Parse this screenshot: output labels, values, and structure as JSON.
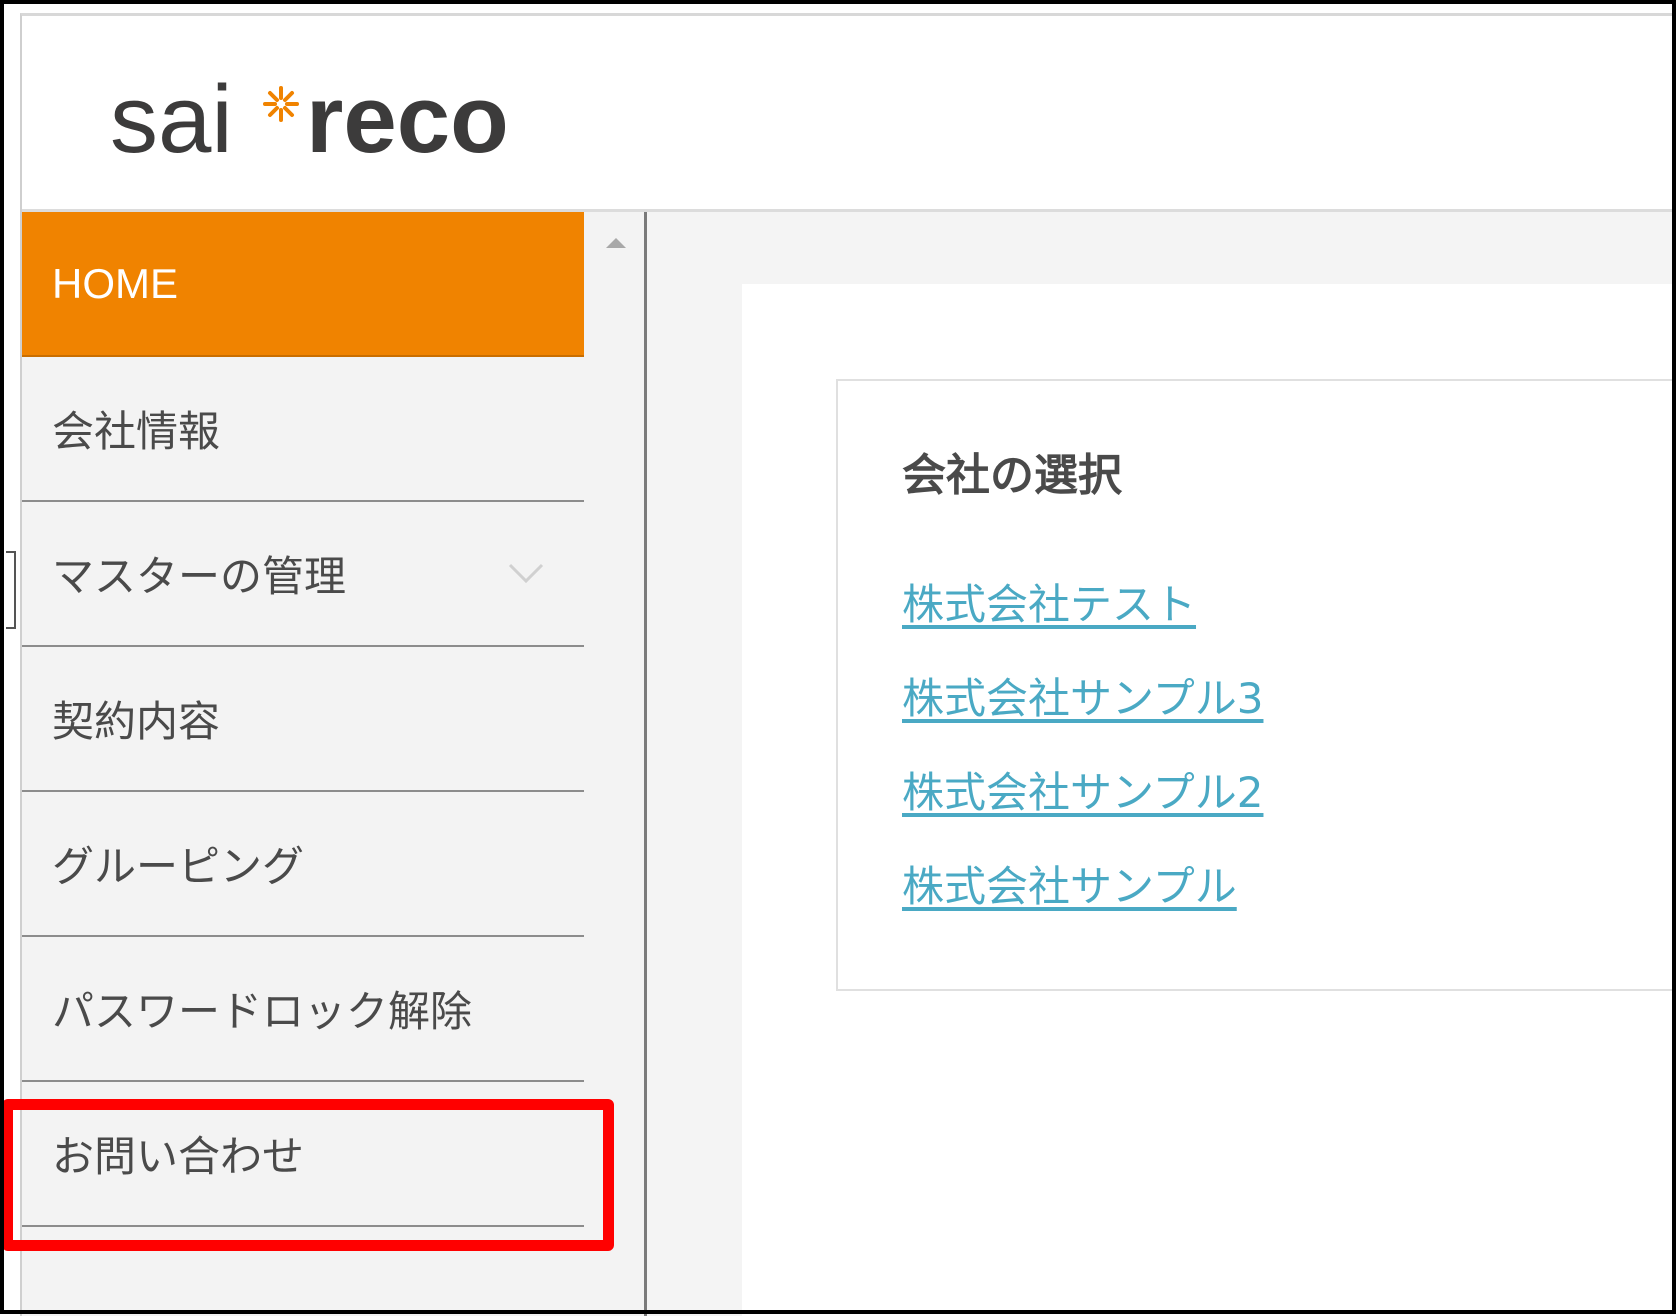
{
  "brand": {
    "logo_left": "sai",
    "logo_right": "reco",
    "accent_color": "#f08300"
  },
  "sidebar": {
    "items": [
      {
        "label": "HOME",
        "active": true
      },
      {
        "label": "会社情報"
      },
      {
        "label": "マスターの管理",
        "has_submenu": true,
        "icon": "chevron-down-icon"
      },
      {
        "label": "契約内容"
      },
      {
        "label": "グルーピング"
      },
      {
        "label": "パスワードロック解除"
      },
      {
        "label": "お問い合わせ",
        "highlighted": true
      }
    ]
  },
  "main": {
    "card_title": "会社の選択",
    "companies": [
      "株式会社テスト",
      "株式会社サンプル3",
      "株式会社サンプル2",
      "株式会社サンプル"
    ],
    "link_color": "#4aa9c4",
    "highlight_color": "#ff0000"
  }
}
